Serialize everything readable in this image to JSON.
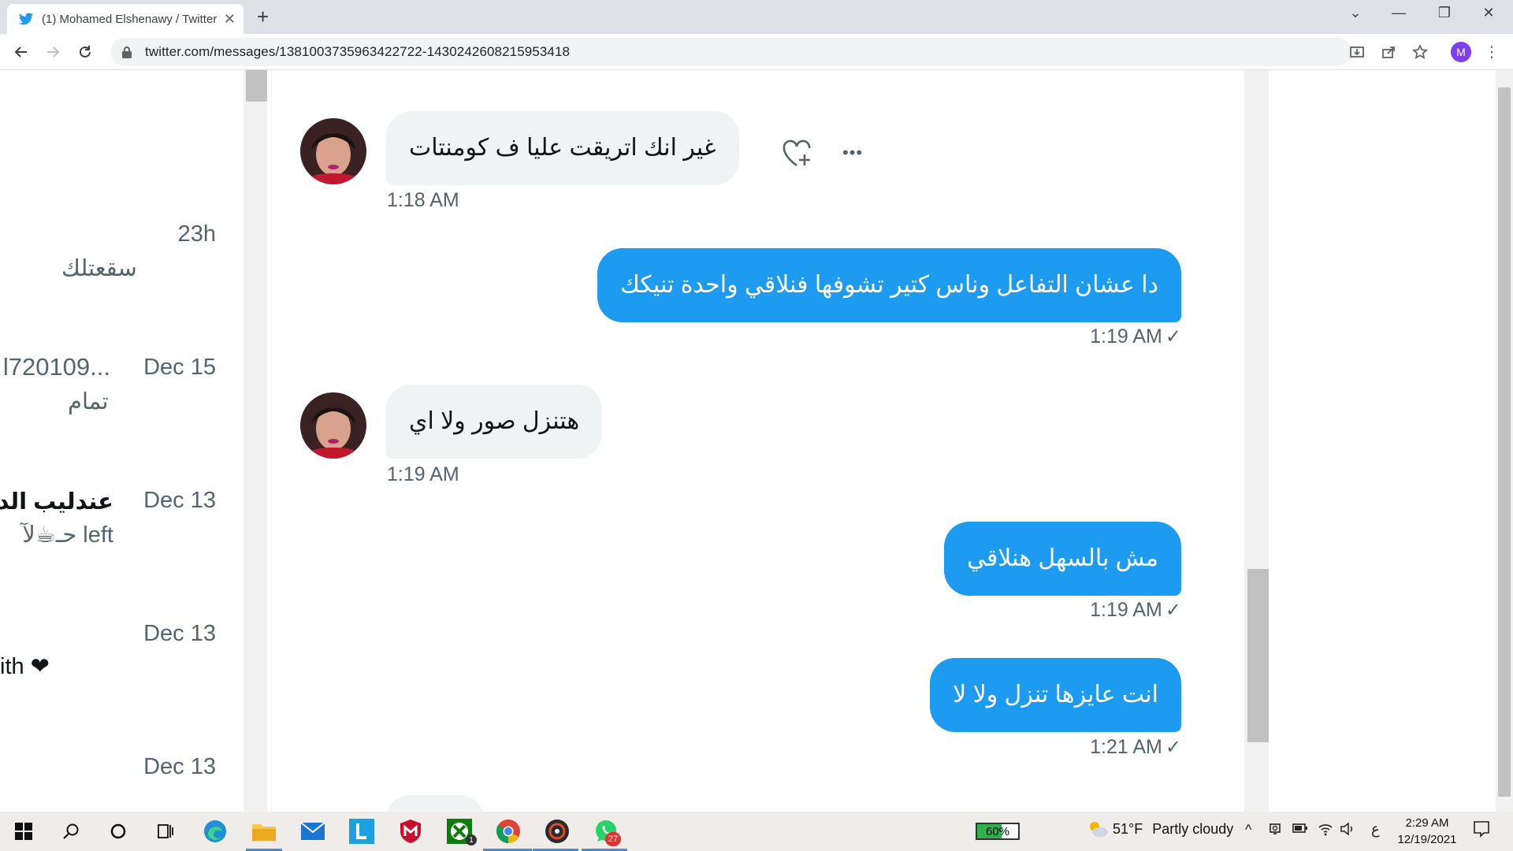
{
  "browser": {
    "tab_title": "(1) Mohamed Elshenawy / Twitter",
    "tab_close": "✕",
    "new_tab": "+",
    "url": "twitter.com/messages/1381003735963422722-1430242608215953418",
    "profile_initial": "M",
    "window_controls": [
      "⌄",
      "—",
      "❐",
      "✕"
    ]
  },
  "conversations": [
    {
      "time": "23h",
      "preview": "سقعتلك"
    },
    {
      "handle": "l720109...",
      "time": "Dec 15",
      "preview": "تمام"
    },
    {
      "name": "عندليب الدن",
      "time": "Dec 13",
      "preview": "حـ☕لآ left"
    },
    {
      "time": "Dec 13",
      "preview": "ith ❤"
    },
    {
      "time": "Dec 13"
    }
  ],
  "messages": [
    {
      "direction": "in",
      "text": "غير انك اتريقت عليا ف كومنتات",
      "time": "1:18 AM"
    },
    {
      "direction": "out",
      "text": "دا عشان التفاعل وناس كتير تشوفها فنلاقي واحدة تنيكك",
      "time": "1:19 AM",
      "status": "✓"
    },
    {
      "direction": "in",
      "text": "هتنزل صور ولا اي",
      "time": "1:19 AM"
    },
    {
      "direction": "out",
      "text": "مش بالسهل هنلاقي",
      "time": "1:19 AM",
      "status": "✓"
    },
    {
      "direction": "out",
      "text": "انت عايزها تنزل ولا لا",
      "time": "1:21 AM",
      "status": "✓"
    }
  ],
  "message_actions": {
    "react": "react-icon",
    "more": "•••"
  },
  "taskbar": {
    "battery": "60%",
    "temperature": "51°F",
    "weather_text": "Partly cloudy",
    "clock_time": "2:29 AM",
    "clock_date": "12/19/2021",
    "language": "ع",
    "badges": {
      "xbox": "1",
      "whatsapp": "27"
    }
  },
  "colors": {
    "accent": "#1d9bf0",
    "incoming_bubble": "#eff3f4",
    "secondary_text": "#536471"
  }
}
